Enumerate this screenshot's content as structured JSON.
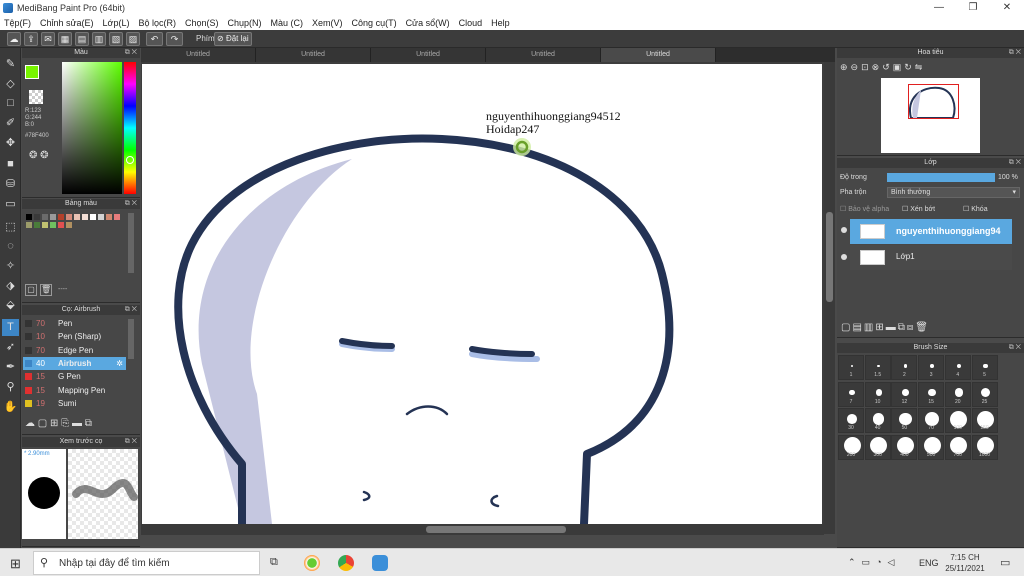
{
  "window": {
    "title": "MediBang Paint Pro (64bit)"
  },
  "menu": [
    "Tệp(F)",
    "Chỉnh sửa(E)",
    "Lớp(L)",
    "Bộ lọc(R)",
    "Chọn(S)",
    "Chụp(N)",
    "Màu (C)",
    "Xem(V)",
    "Công cụ(T)",
    "Cửa sổ(W)",
    "Cloud",
    "Help"
  ],
  "toolbar": {
    "shortcut_label": "Phím",
    "reset_label": "Đặt lại"
  },
  "tabs": [
    "Untitled",
    "Untitled",
    "Untitled",
    "Untitled",
    "Untitled"
  ],
  "color_panel": {
    "title": "Màu",
    "r": "R:123",
    "g": "G:244",
    "b": "B:0",
    "hex": "#78F400",
    "fg_color": "#78F400"
  },
  "palette_panel": {
    "title": "Bảng màu",
    "colors": [
      "#000000",
      "#3a3a3a",
      "#6b6b6b",
      "#9a9a9a",
      "#b3402a",
      "#d38a7a",
      "#e8c2b4",
      "#f5e0d7",
      "#ffffff",
      "#d3d3d3",
      "#d08870",
      "#e87c7c",
      "#9c9c6a",
      "#4a7c3a",
      "#c0c070",
      "#70c060",
      "#e05050",
      "#b09060"
    ]
  },
  "palette_footer": "----",
  "brush_panel": {
    "title": "Cọ: Airbrush",
    "items": [
      {
        "size": "70",
        "name": "Pen",
        "color": "#333333"
      },
      {
        "size": "10",
        "name": "Pen (Sharp)",
        "color": "#333333"
      },
      {
        "size": "70",
        "name": "Edge Pen",
        "color": "#333333"
      },
      {
        "size": "40",
        "name": "Airbrush",
        "color": "#3d86c6",
        "active": true
      },
      {
        "size": "15",
        "name": "G Pen",
        "color": "#e03030"
      },
      {
        "size": "15",
        "name": "Mapping Pen",
        "color": "#e03030"
      },
      {
        "size": "19",
        "name": "Sumi",
        "color": "#e0c020"
      }
    ]
  },
  "preview_panel": {
    "title": "Xem trước cọ",
    "size": "* 2.90mm"
  },
  "navigator_panel": {
    "title": "Hoa tiêu"
  },
  "layer_panel": {
    "title": "Lớp",
    "opacity_label": "Độ trong",
    "opacity_value": "100 %",
    "opacity_fraction": 1.0,
    "blend_label": "Pha trộn",
    "blend_value": "Bình thường",
    "protect_alpha": "Bảo vệ alpha",
    "clipping": "Xén bớt",
    "lock": "Khóa",
    "layers": [
      {
        "name": "nguyenthihuonggiang94",
        "active": true
      },
      {
        "name": "Lớp1",
        "active": false
      }
    ]
  },
  "brush_size_panel": {
    "title": "Brush Size",
    "sizes": [
      "1",
      "1.5",
      "2",
      "3",
      "4",
      "5",
      "7",
      "10",
      "12",
      "15",
      "20",
      "25",
      "30",
      "40",
      "50",
      "70",
      "100",
      "150",
      "200",
      "300",
      "400",
      "500",
      "700",
      "1000"
    ]
  },
  "canvas_text": {
    "line1": "nguyenthihuonggiang94512",
    "line2": "Hoidap247"
  },
  "taskbar": {
    "search_placeholder": "Nhập tại đây để tìm kiếm",
    "lang": "ENG",
    "time": "7:15 CH",
    "date": "25/11/2021"
  }
}
